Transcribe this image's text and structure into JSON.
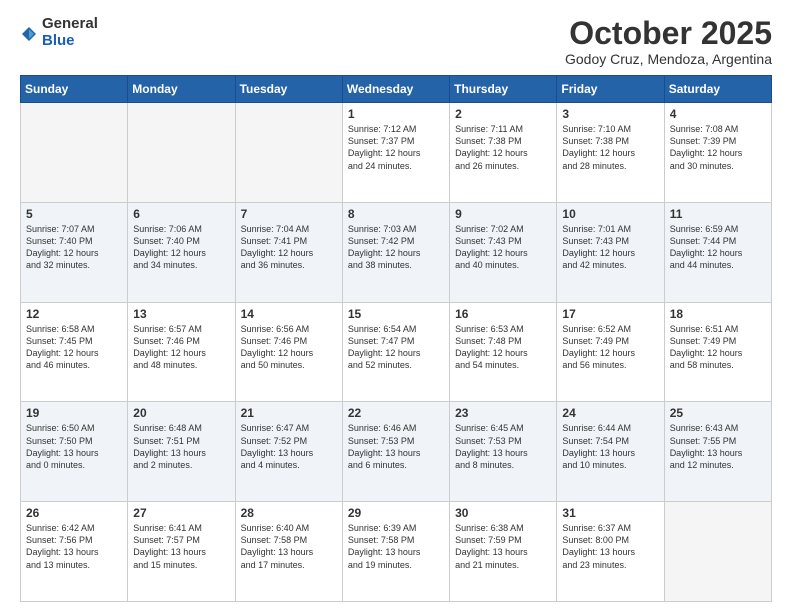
{
  "header": {
    "logo_general": "General",
    "logo_blue": "Blue",
    "title": "October 2025",
    "subtitle": "Godoy Cruz, Mendoza, Argentina"
  },
  "days_of_week": [
    "Sunday",
    "Monday",
    "Tuesday",
    "Wednesday",
    "Thursday",
    "Friday",
    "Saturday"
  ],
  "weeks": [
    [
      {
        "day": "",
        "info": ""
      },
      {
        "day": "",
        "info": ""
      },
      {
        "day": "",
        "info": ""
      },
      {
        "day": "1",
        "info": "Sunrise: 7:12 AM\nSunset: 7:37 PM\nDaylight: 12 hours\nand 24 minutes."
      },
      {
        "day": "2",
        "info": "Sunrise: 7:11 AM\nSunset: 7:38 PM\nDaylight: 12 hours\nand 26 minutes."
      },
      {
        "day": "3",
        "info": "Sunrise: 7:10 AM\nSunset: 7:38 PM\nDaylight: 12 hours\nand 28 minutes."
      },
      {
        "day": "4",
        "info": "Sunrise: 7:08 AM\nSunset: 7:39 PM\nDaylight: 12 hours\nand 30 minutes."
      }
    ],
    [
      {
        "day": "5",
        "info": "Sunrise: 7:07 AM\nSunset: 7:40 PM\nDaylight: 12 hours\nand 32 minutes."
      },
      {
        "day": "6",
        "info": "Sunrise: 7:06 AM\nSunset: 7:40 PM\nDaylight: 12 hours\nand 34 minutes."
      },
      {
        "day": "7",
        "info": "Sunrise: 7:04 AM\nSunset: 7:41 PM\nDaylight: 12 hours\nand 36 minutes."
      },
      {
        "day": "8",
        "info": "Sunrise: 7:03 AM\nSunset: 7:42 PM\nDaylight: 12 hours\nand 38 minutes."
      },
      {
        "day": "9",
        "info": "Sunrise: 7:02 AM\nSunset: 7:43 PM\nDaylight: 12 hours\nand 40 minutes."
      },
      {
        "day": "10",
        "info": "Sunrise: 7:01 AM\nSunset: 7:43 PM\nDaylight: 12 hours\nand 42 minutes."
      },
      {
        "day": "11",
        "info": "Sunrise: 6:59 AM\nSunset: 7:44 PM\nDaylight: 12 hours\nand 44 minutes."
      }
    ],
    [
      {
        "day": "12",
        "info": "Sunrise: 6:58 AM\nSunset: 7:45 PM\nDaylight: 12 hours\nand 46 minutes."
      },
      {
        "day": "13",
        "info": "Sunrise: 6:57 AM\nSunset: 7:46 PM\nDaylight: 12 hours\nand 48 minutes."
      },
      {
        "day": "14",
        "info": "Sunrise: 6:56 AM\nSunset: 7:46 PM\nDaylight: 12 hours\nand 50 minutes."
      },
      {
        "day": "15",
        "info": "Sunrise: 6:54 AM\nSunset: 7:47 PM\nDaylight: 12 hours\nand 52 minutes."
      },
      {
        "day": "16",
        "info": "Sunrise: 6:53 AM\nSunset: 7:48 PM\nDaylight: 12 hours\nand 54 minutes."
      },
      {
        "day": "17",
        "info": "Sunrise: 6:52 AM\nSunset: 7:49 PM\nDaylight: 12 hours\nand 56 minutes."
      },
      {
        "day": "18",
        "info": "Sunrise: 6:51 AM\nSunset: 7:49 PM\nDaylight: 12 hours\nand 58 minutes."
      }
    ],
    [
      {
        "day": "19",
        "info": "Sunrise: 6:50 AM\nSunset: 7:50 PM\nDaylight: 13 hours\nand 0 minutes."
      },
      {
        "day": "20",
        "info": "Sunrise: 6:48 AM\nSunset: 7:51 PM\nDaylight: 13 hours\nand 2 minutes."
      },
      {
        "day": "21",
        "info": "Sunrise: 6:47 AM\nSunset: 7:52 PM\nDaylight: 13 hours\nand 4 minutes."
      },
      {
        "day": "22",
        "info": "Sunrise: 6:46 AM\nSunset: 7:53 PM\nDaylight: 13 hours\nand 6 minutes."
      },
      {
        "day": "23",
        "info": "Sunrise: 6:45 AM\nSunset: 7:53 PM\nDaylight: 13 hours\nand 8 minutes."
      },
      {
        "day": "24",
        "info": "Sunrise: 6:44 AM\nSunset: 7:54 PM\nDaylight: 13 hours\nand 10 minutes."
      },
      {
        "day": "25",
        "info": "Sunrise: 6:43 AM\nSunset: 7:55 PM\nDaylight: 13 hours\nand 12 minutes."
      }
    ],
    [
      {
        "day": "26",
        "info": "Sunrise: 6:42 AM\nSunset: 7:56 PM\nDaylight: 13 hours\nand 13 minutes."
      },
      {
        "day": "27",
        "info": "Sunrise: 6:41 AM\nSunset: 7:57 PM\nDaylight: 13 hours\nand 15 minutes."
      },
      {
        "day": "28",
        "info": "Sunrise: 6:40 AM\nSunset: 7:58 PM\nDaylight: 13 hours\nand 17 minutes."
      },
      {
        "day": "29",
        "info": "Sunrise: 6:39 AM\nSunset: 7:58 PM\nDaylight: 13 hours\nand 19 minutes."
      },
      {
        "day": "30",
        "info": "Sunrise: 6:38 AM\nSunset: 7:59 PM\nDaylight: 13 hours\nand 21 minutes."
      },
      {
        "day": "31",
        "info": "Sunrise: 6:37 AM\nSunset: 8:00 PM\nDaylight: 13 hours\nand 23 minutes."
      },
      {
        "day": "",
        "info": ""
      }
    ]
  ]
}
